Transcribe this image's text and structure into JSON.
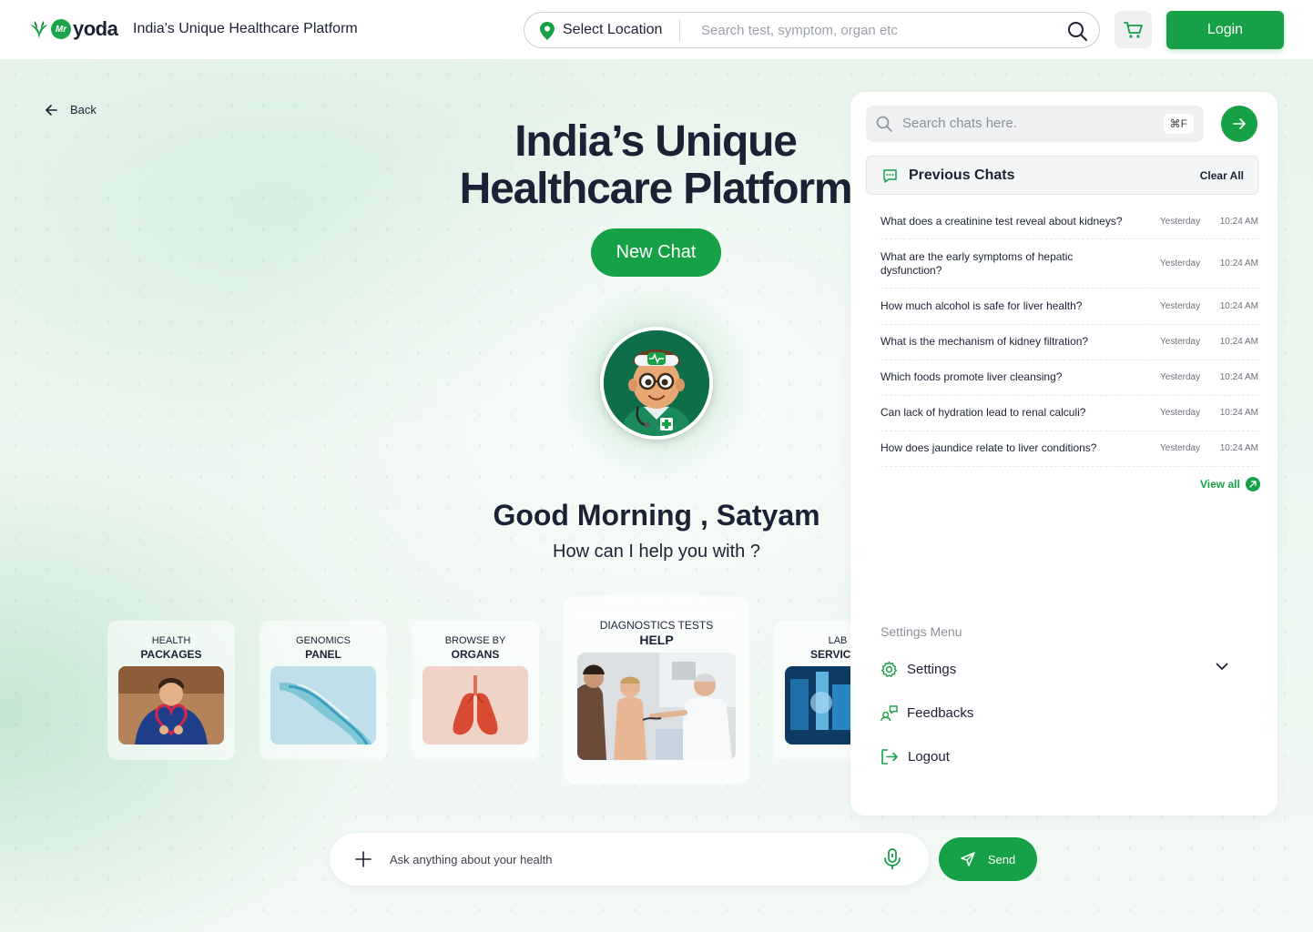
{
  "header": {
    "logo_prefix": "Mr",
    "logo_name": "yoda",
    "tagline": "India's Unique Healthcare Platform",
    "location_label": "Select Location",
    "search_placeholder": "Search test, symptom, organ etc",
    "login_label": "Login"
  },
  "back_label": "Back",
  "hero": {
    "title": "India’s Unique Healthcare Platform",
    "new_chat_label": "New Chat",
    "greeting": "Good Morning , Satyam",
    "subtitle": "How can I help you with ?"
  },
  "cards": [
    {
      "line1": "HEALTH",
      "line2": "PACKAGES"
    },
    {
      "line1": "GENOMICS",
      "line2": "PANEL"
    },
    {
      "line1": "BROWSE BY",
      "line2": "ORGANS"
    },
    {
      "line1": "DIAGNOSTICS TESTS",
      "line2": "HELP"
    },
    {
      "line1": "LAB",
      "line2": "SERVIC"
    }
  ],
  "composer": {
    "placeholder": "Ask anything about your health",
    "send_label": "Send"
  },
  "panel": {
    "search_placeholder": "Search chats here.",
    "shortcut": "⌘F",
    "previous_title": "Previous Chats",
    "clear_all": "Clear All",
    "chats": [
      {
        "q": "What does a creatinine test reveal about kidneys?",
        "day": "Yesterday",
        "time": "10:24 AM"
      },
      {
        "q": "What are the early symptoms of hepatic dysfunction?",
        "day": "Yesterday",
        "time": "10:24 AM"
      },
      {
        "q": "How much alcohol is safe for liver health?",
        "day": "Yesterday",
        "time": "10:24 AM"
      },
      {
        "q": "What is the mechanism of kidney filtration?",
        "day": "Yesterday",
        "time": "10:24 AM"
      },
      {
        "q": "Which foods promote liver cleansing?",
        "day": "Yesterday",
        "time": "10:24 AM"
      },
      {
        "q": "Can lack of hydration lead to renal calculi?",
        "day": "Yesterday",
        "time": "10:24 AM"
      },
      {
        "q": "How does jaundice relate to liver conditions?",
        "day": "Yesterday",
        "time": "10:24 AM"
      }
    ],
    "view_all": "View all",
    "settings_menu_label": "Settings Menu",
    "menu": {
      "settings": "Settings",
      "feedbacks": "Feedbacks",
      "logout": "Logout"
    }
  },
  "colors": {
    "accent": "#17a146",
    "text": "#1c2235"
  }
}
